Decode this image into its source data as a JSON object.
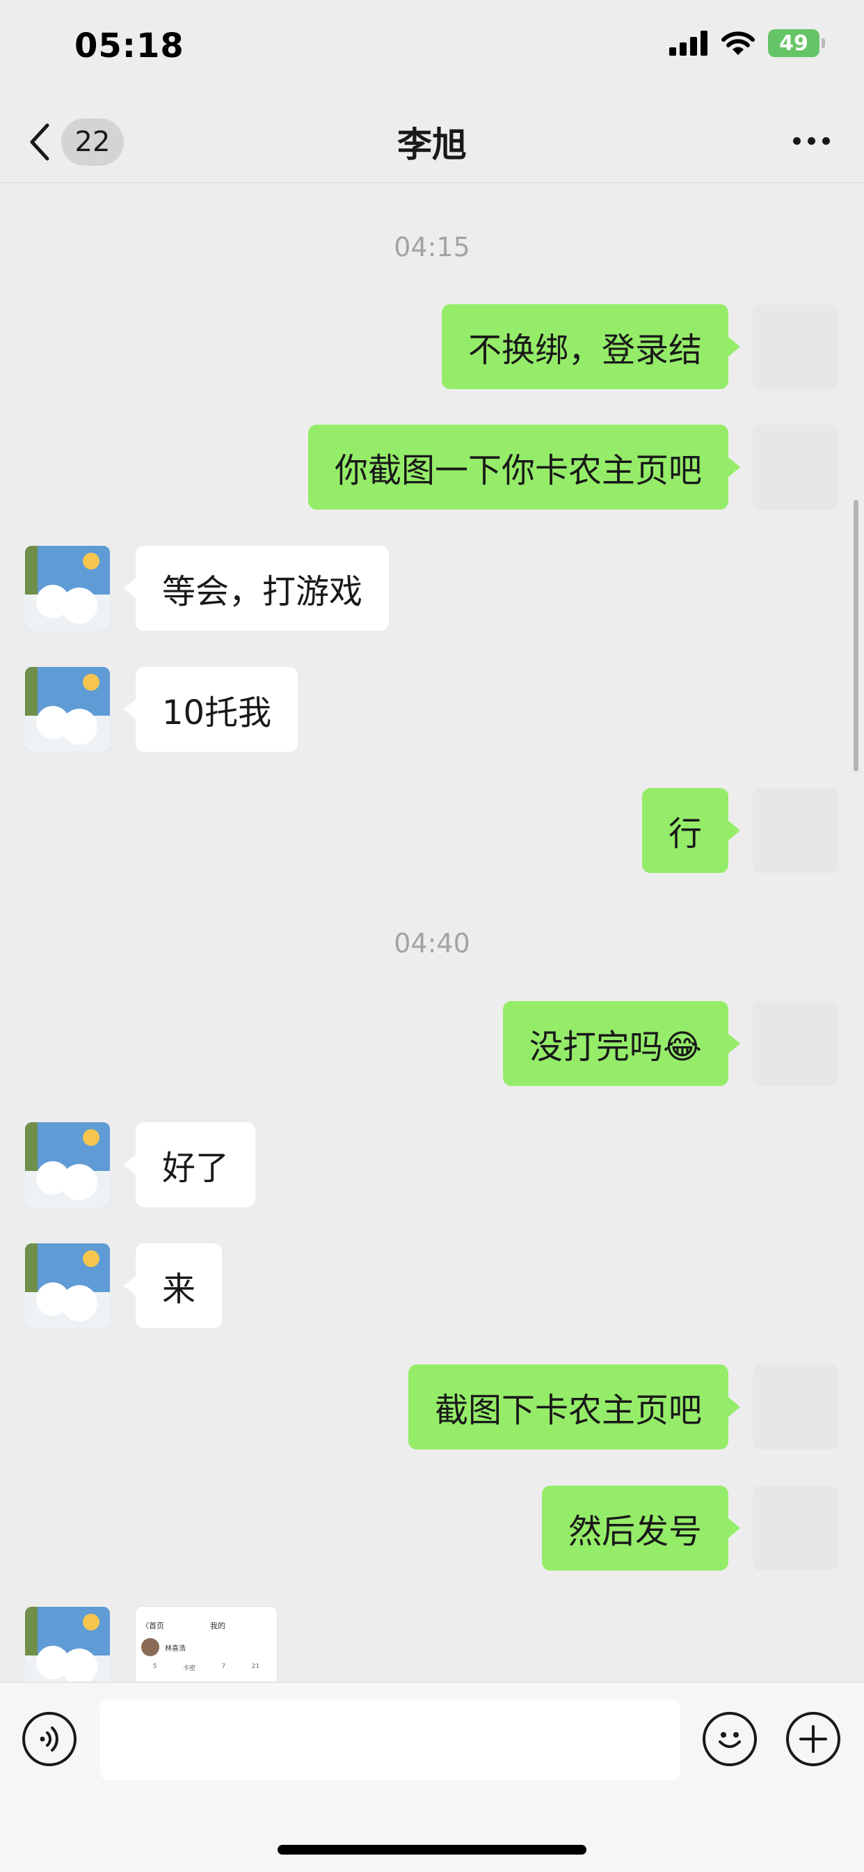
{
  "status_bar": {
    "time": "05:18",
    "battery": "49"
  },
  "nav": {
    "unread_count": "22",
    "title": "李旭"
  },
  "messages": [
    {
      "type": "time",
      "text": "04:15"
    },
    {
      "type": "out",
      "text": "不换绑，登录结"
    },
    {
      "type": "out",
      "text": "你截图一下你卡农主页吧"
    },
    {
      "type": "in",
      "text": "等会，打游戏"
    },
    {
      "type": "in",
      "text": "10托我"
    },
    {
      "type": "out",
      "text": "行"
    },
    {
      "type": "time",
      "text": "04:40"
    },
    {
      "type": "out",
      "text": "没打完吗😂"
    },
    {
      "type": "in",
      "text": "好了"
    },
    {
      "type": "in",
      "text": "来"
    },
    {
      "type": "out",
      "text": "截图下卡农主页吧"
    },
    {
      "type": "out",
      "text": "然后发号"
    },
    {
      "type": "in-image",
      "image": {
        "nav_left": "〈首页",
        "nav_center": "我的",
        "name": "林喜浩",
        "stats": [
          "5",
          "卡密",
          "7",
          "21"
        ]
      }
    }
  ],
  "input": {
    "placeholder": ""
  }
}
